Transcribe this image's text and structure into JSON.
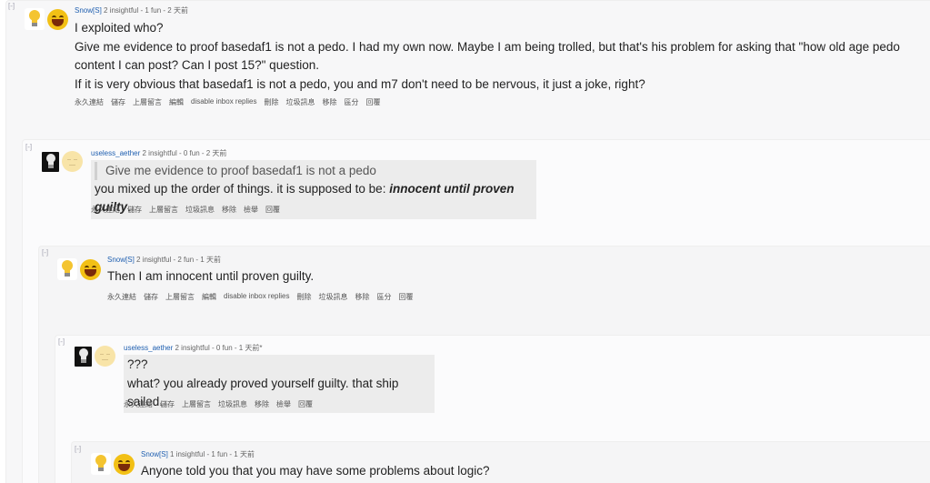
{
  "collapse_label": "[-]",
  "comments": [
    {
      "author": "Snow",
      "op_tag": "[S]",
      "stats": "2 insightful - 1 fun - 2 天前",
      "paragraphs": [
        "I exploited who?",
        "Give me evidence to proof basedaf1 is not a pedo. I had my own now. Maybe I am being trolled, but that's his problem for asking that \"how old age pedo content I can post? Can I post 15?\" question.",
        "If it is very obvious that basedaf1 is not a pedo, you and m7 don't need to be nervous, it just a joke, right?"
      ],
      "actions": [
        "永久連結",
        "儲存",
        "上層留言",
        "編輯",
        "disable inbox replies",
        "刪除",
        "垃圾訊息",
        "移除",
        "區分",
        "回覆"
      ]
    },
    {
      "author": "useless_aether",
      "stats": "2 insightful - 0 fun - 2 天前",
      "quote": "Give me evidence to proof basedaf1 is not a pedo",
      "text_before": "you mixed up the order of things. it is supposed to be: ",
      "text_emph": "innocent until proven guilty",
      "text_after": ".",
      "actions": [
        "永久連結",
        "儲存",
        "上層留言",
        "垃圾訊息",
        "移除",
        "檢舉",
        "回覆"
      ]
    },
    {
      "author": "Snow",
      "op_tag": "[S]",
      "stats": "2 insightful - 2 fun - 1 天前",
      "paragraphs": [
        "Then I am innocent until proven guilty."
      ],
      "actions": [
        "永久連結",
        "儲存",
        "上層留言",
        "編輯",
        "disable inbox replies",
        "刪除",
        "垃圾訊息",
        "移除",
        "區分",
        "回覆"
      ]
    },
    {
      "author": "useless_aether",
      "stats": "2 insightful - 0 fun - 1 天前*",
      "paragraphs": [
        "???",
        "what? you already proved yourself guilty. that ship sailed."
      ],
      "actions": [
        "永久連結",
        "儲存",
        "上層留言",
        "垃圾訊息",
        "移除",
        "檢舉",
        "回覆"
      ]
    },
    {
      "author": "Snow",
      "op_tag": "[S]",
      "stats": "1 insightful - 1 fun - 1 天前",
      "paragraphs": [
        "Anyone told you that you may have some problems about logic?"
      ]
    }
  ]
}
